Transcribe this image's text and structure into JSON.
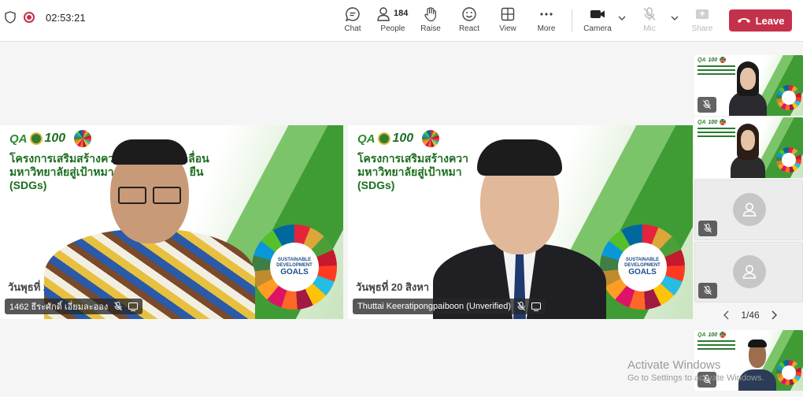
{
  "meeting": {
    "timer": "02:53:21"
  },
  "toolbar": {
    "chat_label": "Chat",
    "people_label": "People",
    "people_count": "184",
    "raise_label": "Raise",
    "react_label": "React",
    "view_label": "View",
    "more_label": "More",
    "camera_label": "Camera",
    "mic_label": "Mic",
    "share_label": "Share",
    "leave_label": "Leave"
  },
  "slide": {
    "logo_qa": "QA",
    "logo_100": "100",
    "title_line1_left": "โครงการเสริมสร้างควา",
    "title_line1_right": "เคลื่อน",
    "title_line2_left": "มหาวิทยาลัยสู่เป้าหมา",
    "title_line2_right": "ยืน",
    "title_line3": "(SDGs)",
    "date_left_tile": "วันพุธที่ 2",
    "date_right_tile": "วันพุธที่ 20 สิงหา",
    "sdg_line1": "SUSTAINABLE",
    "sdg_line2": "DEVELOPMENT",
    "sdg_line3": "GOALS"
  },
  "participants": {
    "main_left_name": "1462 ธีระศักดิ์ เอี่ยมละออง",
    "main_right_name": "Thuttai Keeratipongpaiboon (Unverified)"
  },
  "pager": {
    "text": "1/46"
  },
  "watermark": {
    "line1": "Activate Windows",
    "line2": "Go to Settings to activate Windows."
  },
  "colors": {
    "leave": "#c4314b",
    "slide_green": "#3f9c35",
    "slide_title": "#1b6e1f"
  }
}
